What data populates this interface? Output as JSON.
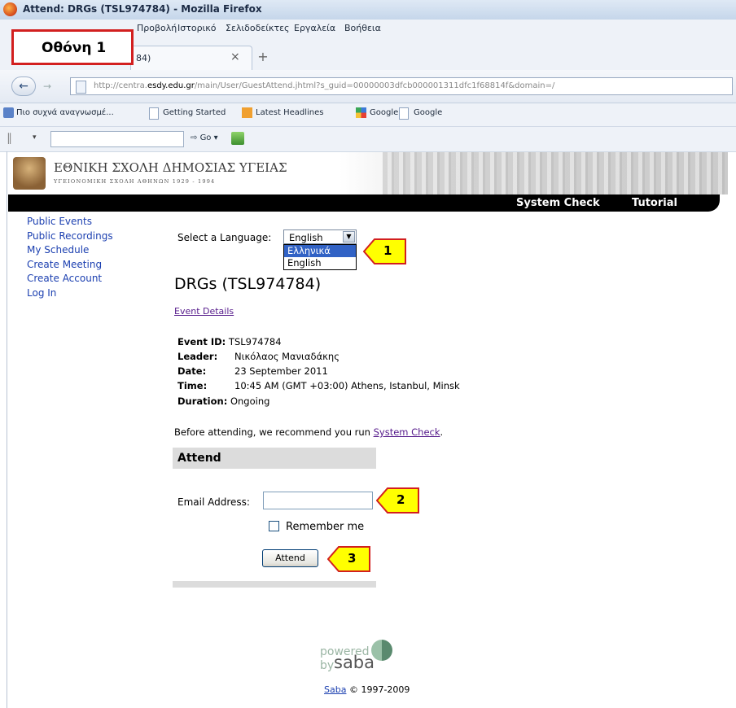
{
  "window": {
    "title": "Attend: DRGs (TSL974784) - Mozilla Firefox"
  },
  "menu": [
    "Προβολή",
    "Ιστορικό",
    "Σελιδοδείκτες",
    "Εργαλεία",
    "Βοήθεια"
  ],
  "screen_label": "Οθόνη 1",
  "tab": {
    "label": "84)",
    "close": "×",
    "new": "+"
  },
  "nav": {
    "url_prefix": "http://centra.",
    "url_host": "esdy.edu.gr",
    "url_rest": "/main/User/GuestAttend.jhtml?s_guid=00000003dfcb000001311dfc1f68814f&domain=/"
  },
  "bookmarks": [
    "Πιο συχνά αναγνωσμέ...",
    "Getting Started",
    "Latest Headlines",
    "Google",
    "Google"
  ],
  "search": {
    "go": "Go"
  },
  "site": {
    "school_name": "ΕΘΝΙΚΗ ΣΧΟΛΗ ΔΗΜΟΣΙΑΣ ΥΓΕΙΑΣ",
    "school_sub": "ΥΓΕΙΟΝΟΜΙΚΗ ΣΧΟΛΗ ΑΘΗΝΩΝ 1929 - 1994",
    "top_links": [
      "System Check",
      "Tutorial"
    ]
  },
  "sidebar": [
    "Public Events",
    "Public Recordings",
    "My Schedule",
    "Create Meeting",
    "Create Account",
    "Log In"
  ],
  "language": {
    "label": "Select a Language:",
    "selected": "English",
    "options": [
      "Ελληνικά",
      "English"
    ]
  },
  "event": {
    "title": "DRGs (TSL974784)",
    "details_link": "Event Details",
    "fields": [
      {
        "label": "Event ID:",
        "value": "TSL974784"
      },
      {
        "label": "Leader:",
        "value": "Νικόλαος Μανιαδάκης"
      },
      {
        "label": "Date:",
        "value": "23 September 2011"
      },
      {
        "label": "Time:",
        "value": "10:45 AM (GMT +03:00) Athens, Istanbul, Minsk"
      },
      {
        "label": "Duration:",
        "value": "Ongoing"
      }
    ],
    "recommend_pre": "Before attending, we recommend you run ",
    "recommend_link": "System Check",
    "recommend_post": "."
  },
  "attend": {
    "heading": "Attend",
    "email_label": "Email Address:",
    "email_value": "",
    "remember_label": "Remember me",
    "remember_checked": false,
    "button": "Attend"
  },
  "callouts": [
    "1",
    "2",
    "3"
  ],
  "footer": {
    "powered": "powered",
    "by": "by",
    "brand": "saba",
    "copy_link": "Saba",
    "copy_text": "© 1997-2009"
  },
  "colors": {
    "callout_fill": "#ffff00",
    "callout_border": "#d21f1f",
    "link": "#1b3fb0",
    "visited": "#551a8b"
  }
}
